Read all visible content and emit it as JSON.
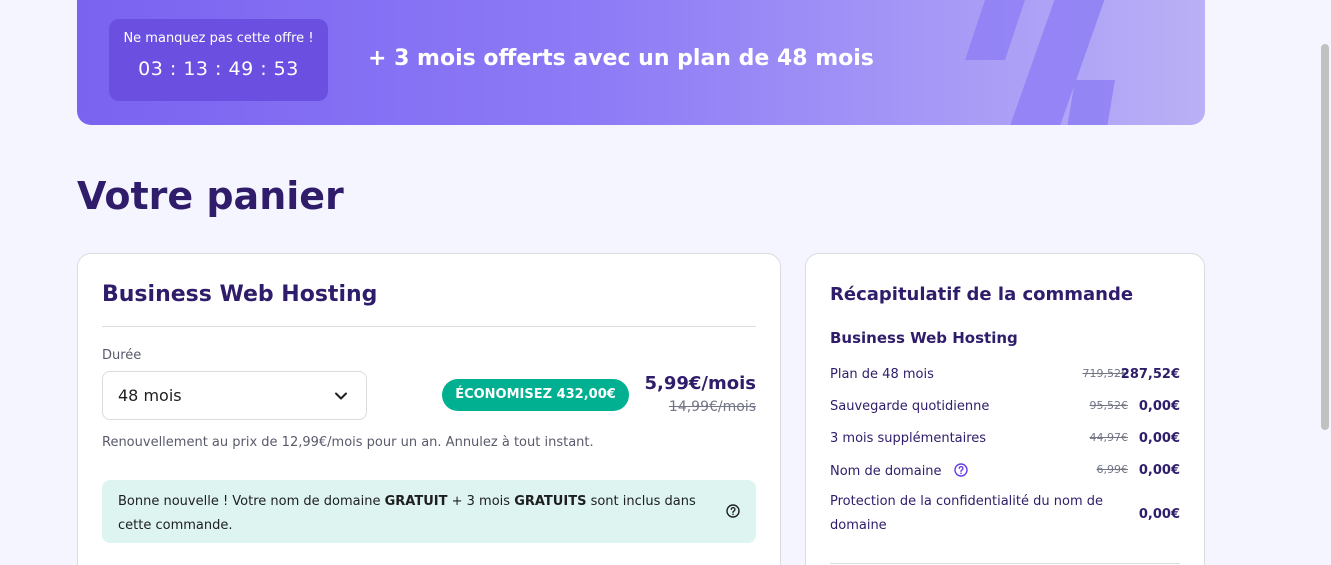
{
  "banner": {
    "timer_label": "Ne manquez pas cette offre !",
    "timer_value": "03 : 13 : 49 : 53",
    "offer_text": "+ 3 mois offerts avec un plan de 48 mois"
  },
  "page": {
    "title": "Votre panier"
  },
  "cart": {
    "product_name": "Business Web Hosting",
    "duration_label": "Durée",
    "duration_value": "48 mois",
    "savings_badge": "ÉCONOMISEZ 432,00€",
    "price_now": "5,99€/mois",
    "price_old": "14,99€/mois",
    "renewal_note": "Renouvellement au prix de 12,99€/mois pour un an. Annulez à tout instant.",
    "good_news": {
      "part1": "Bonne nouvelle ! Votre nom de domaine ",
      "bold1": "GRATUIT",
      "part2": " + 3 mois ",
      "bold2": "GRATUITS",
      "part3": " sont inclus dans cette commande."
    }
  },
  "summary": {
    "title": "Récapitulatif de la commande",
    "product_name": "Business Web Hosting",
    "rows": [
      {
        "label": "Plan de 48 mois",
        "old": "719,52€",
        "value": "287,52€"
      },
      {
        "label": "Sauvegarde quotidienne",
        "old": "95,52€",
        "value": "0,00€"
      },
      {
        "label": "3 mois supplémentaires",
        "old": "44,97€",
        "value": "0,00€"
      },
      {
        "label": "Nom de domaine",
        "old": "6,99€",
        "value": "0,00€"
      },
      {
        "label": "Protection de la confidentialité du nom de domaine",
        "old": "",
        "value": "0,00€"
      }
    ]
  },
  "colors": {
    "brand": "#673de6",
    "title": "#2f1c6a",
    "badge_green": "#00b090",
    "info_bg": "#def4f0"
  },
  "icons": [
    "percent-icon",
    "chevron-down-icon",
    "help-circle-icon"
  ]
}
